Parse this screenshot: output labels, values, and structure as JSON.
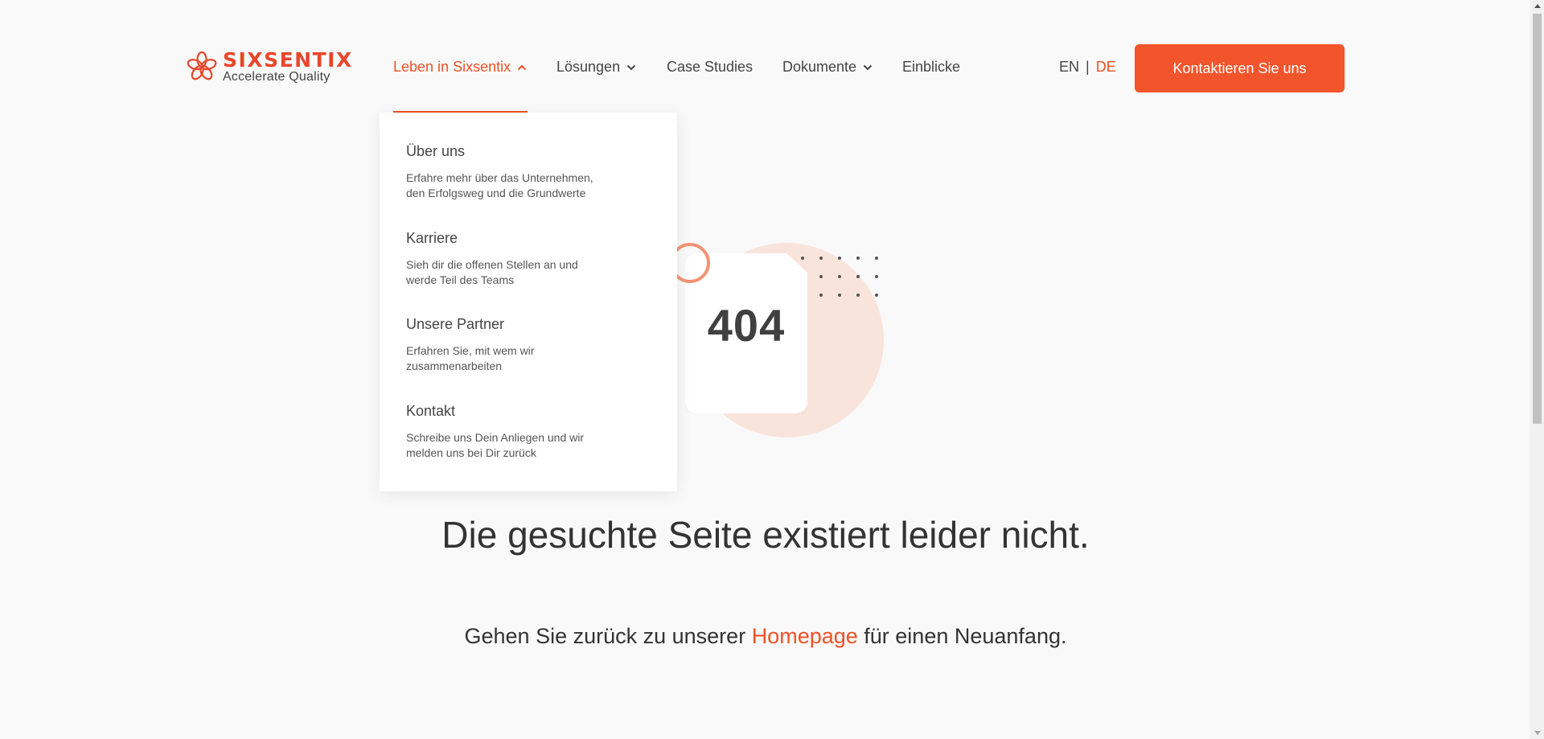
{
  "header": {
    "logo": {
      "brand": "SIXSENTIX",
      "tagline": "Accelerate Quality"
    },
    "nav": [
      {
        "label": "Leben in Sixsentix",
        "has_dropdown": true,
        "active": true
      },
      {
        "label": "Lösungen",
        "has_dropdown": true,
        "active": false
      },
      {
        "label": "Case Studies",
        "has_dropdown": false,
        "active": false
      },
      {
        "label": "Dokumente",
        "has_dropdown": true,
        "active": false
      },
      {
        "label": "Einblicke",
        "has_dropdown": false,
        "active": false
      }
    ],
    "lang": {
      "en": "EN",
      "separator": "|",
      "de": "DE",
      "selected": "DE"
    },
    "cta_label": "Kontaktieren Sie uns"
  },
  "dropdown": {
    "items": [
      {
        "title": "Über uns",
        "description": "Erfahre mehr über das Unternehmen, den Erfolgsweg und die Grundwerte"
      },
      {
        "title": "Karriere",
        "description": "Sieh dir die offenen Stellen an und werde Teil des Teams"
      },
      {
        "title": "Unsere Partner",
        "description": "Erfahren Sie, mit wem wir zusammenarbeiten"
      },
      {
        "title": "Kontakt",
        "description": "Schreibe uns Dein Anliegen und wir melden uns bei Dir zurück"
      }
    ]
  },
  "error": {
    "code": "404",
    "headline": "Die gesuchte Seite existiert leider nicht.",
    "sub_before": "Gehen Sie zurück zu unserer ",
    "sub_link": "Homepage",
    "sub_after": " für einen Neuanfang."
  },
  "colors": {
    "accent": "#ef5128",
    "blob": "#f9e4dc",
    "ring": "#f19374"
  }
}
